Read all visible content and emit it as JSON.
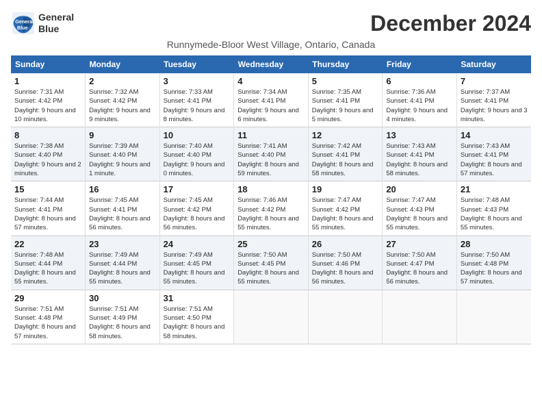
{
  "logo": {
    "line1": "General",
    "line2": "Blue"
  },
  "title": "December 2024",
  "location": "Runnymede-Bloor West Village, Ontario, Canada",
  "weekdays": [
    "Sunday",
    "Monday",
    "Tuesday",
    "Wednesday",
    "Thursday",
    "Friday",
    "Saturday"
  ],
  "weeks": [
    [
      {
        "day": "1",
        "rise": "7:31 AM",
        "set": "4:42 PM",
        "light": "9 hours and 10 minutes."
      },
      {
        "day": "2",
        "rise": "7:32 AM",
        "set": "4:42 PM",
        "light": "9 hours and 9 minutes."
      },
      {
        "day": "3",
        "rise": "7:33 AM",
        "set": "4:41 PM",
        "light": "9 hours and 8 minutes."
      },
      {
        "day": "4",
        "rise": "7:34 AM",
        "set": "4:41 PM",
        "light": "9 hours and 6 minutes."
      },
      {
        "day": "5",
        "rise": "7:35 AM",
        "set": "4:41 PM",
        "light": "9 hours and 5 minutes."
      },
      {
        "day": "6",
        "rise": "7:36 AM",
        "set": "4:41 PM",
        "light": "9 hours and 4 minutes."
      },
      {
        "day": "7",
        "rise": "7:37 AM",
        "set": "4:41 PM",
        "light": "9 hours and 3 minutes."
      }
    ],
    [
      {
        "day": "8",
        "rise": "7:38 AM",
        "set": "4:40 PM",
        "light": "9 hours and 2 minutes."
      },
      {
        "day": "9",
        "rise": "7:39 AM",
        "set": "4:40 PM",
        "light": "9 hours and 1 minute."
      },
      {
        "day": "10",
        "rise": "7:40 AM",
        "set": "4:40 PM",
        "light": "9 hours and 0 minutes."
      },
      {
        "day": "11",
        "rise": "7:41 AM",
        "set": "4:40 PM",
        "light": "8 hours and 59 minutes."
      },
      {
        "day": "12",
        "rise": "7:42 AM",
        "set": "4:41 PM",
        "light": "8 hours and 58 minutes."
      },
      {
        "day": "13",
        "rise": "7:43 AM",
        "set": "4:41 PM",
        "light": "8 hours and 58 minutes."
      },
      {
        "day": "14",
        "rise": "7:43 AM",
        "set": "4:41 PM",
        "light": "8 hours and 57 minutes."
      }
    ],
    [
      {
        "day": "15",
        "rise": "7:44 AM",
        "set": "4:41 PM",
        "light": "8 hours and 57 minutes."
      },
      {
        "day": "16",
        "rise": "7:45 AM",
        "set": "4:41 PM",
        "light": "8 hours and 56 minutes."
      },
      {
        "day": "17",
        "rise": "7:45 AM",
        "set": "4:42 PM",
        "light": "8 hours and 56 minutes."
      },
      {
        "day": "18",
        "rise": "7:46 AM",
        "set": "4:42 PM",
        "light": "8 hours and 55 minutes."
      },
      {
        "day": "19",
        "rise": "7:47 AM",
        "set": "4:42 PM",
        "light": "8 hours and 55 minutes."
      },
      {
        "day": "20",
        "rise": "7:47 AM",
        "set": "4:43 PM",
        "light": "8 hours and 55 minutes."
      },
      {
        "day": "21",
        "rise": "7:48 AM",
        "set": "4:43 PM",
        "light": "8 hours and 55 minutes."
      }
    ],
    [
      {
        "day": "22",
        "rise": "7:48 AM",
        "set": "4:44 PM",
        "light": "8 hours and 55 minutes."
      },
      {
        "day": "23",
        "rise": "7:49 AM",
        "set": "4:44 PM",
        "light": "8 hours and 55 minutes."
      },
      {
        "day": "24",
        "rise": "7:49 AM",
        "set": "4:45 PM",
        "light": "8 hours and 55 minutes."
      },
      {
        "day": "25",
        "rise": "7:50 AM",
        "set": "4:45 PM",
        "light": "8 hours and 55 minutes."
      },
      {
        "day": "26",
        "rise": "7:50 AM",
        "set": "4:46 PM",
        "light": "8 hours and 56 minutes."
      },
      {
        "day": "27",
        "rise": "7:50 AM",
        "set": "4:47 PM",
        "light": "8 hours and 56 minutes."
      },
      {
        "day": "28",
        "rise": "7:50 AM",
        "set": "4:48 PM",
        "light": "8 hours and 57 minutes."
      }
    ],
    [
      {
        "day": "29",
        "rise": "7:51 AM",
        "set": "4:48 PM",
        "light": "8 hours and 57 minutes."
      },
      {
        "day": "30",
        "rise": "7:51 AM",
        "set": "4:49 PM",
        "light": "8 hours and 58 minutes."
      },
      {
        "day": "31",
        "rise": "7:51 AM",
        "set": "4:50 PM",
        "light": "8 hours and 58 minutes."
      },
      null,
      null,
      null,
      null
    ]
  ]
}
